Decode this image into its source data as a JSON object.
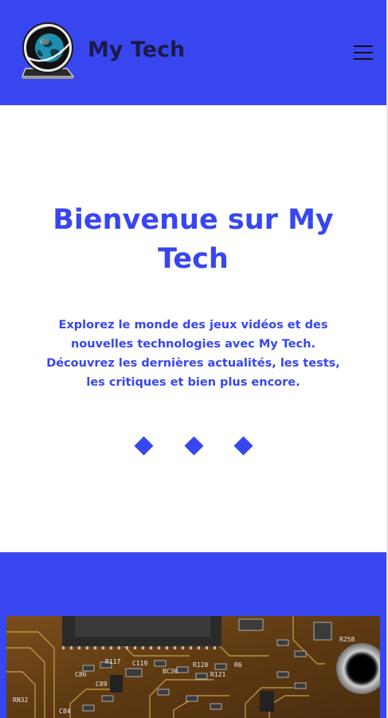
{
  "theme": {
    "accent": "#3846f0",
    "title_color": "#1c1a4a"
  },
  "header": {
    "logo_icon": "globe-laptop-logo-icon",
    "site_title": "My Tech",
    "menu_icon": "hamburger-menu-icon"
  },
  "hero": {
    "title": "Bienvenue sur My Tech",
    "text": "Explorez le monde des jeux vidéos et des nouvelles technologies avec My Tech. Découvrez les dernières actualités, les tests, les critiques et bien plus encore.",
    "decor_icon": "diamond-icon"
  },
  "feature": {
    "image_icon": "circuit-board-image",
    "board_labels": [
      "RN32",
      "C86",
      "C89",
      "R117",
      "C119",
      "BC30",
      "R120",
      "R121",
      "R6",
      "R258",
      "C84"
    ]
  }
}
